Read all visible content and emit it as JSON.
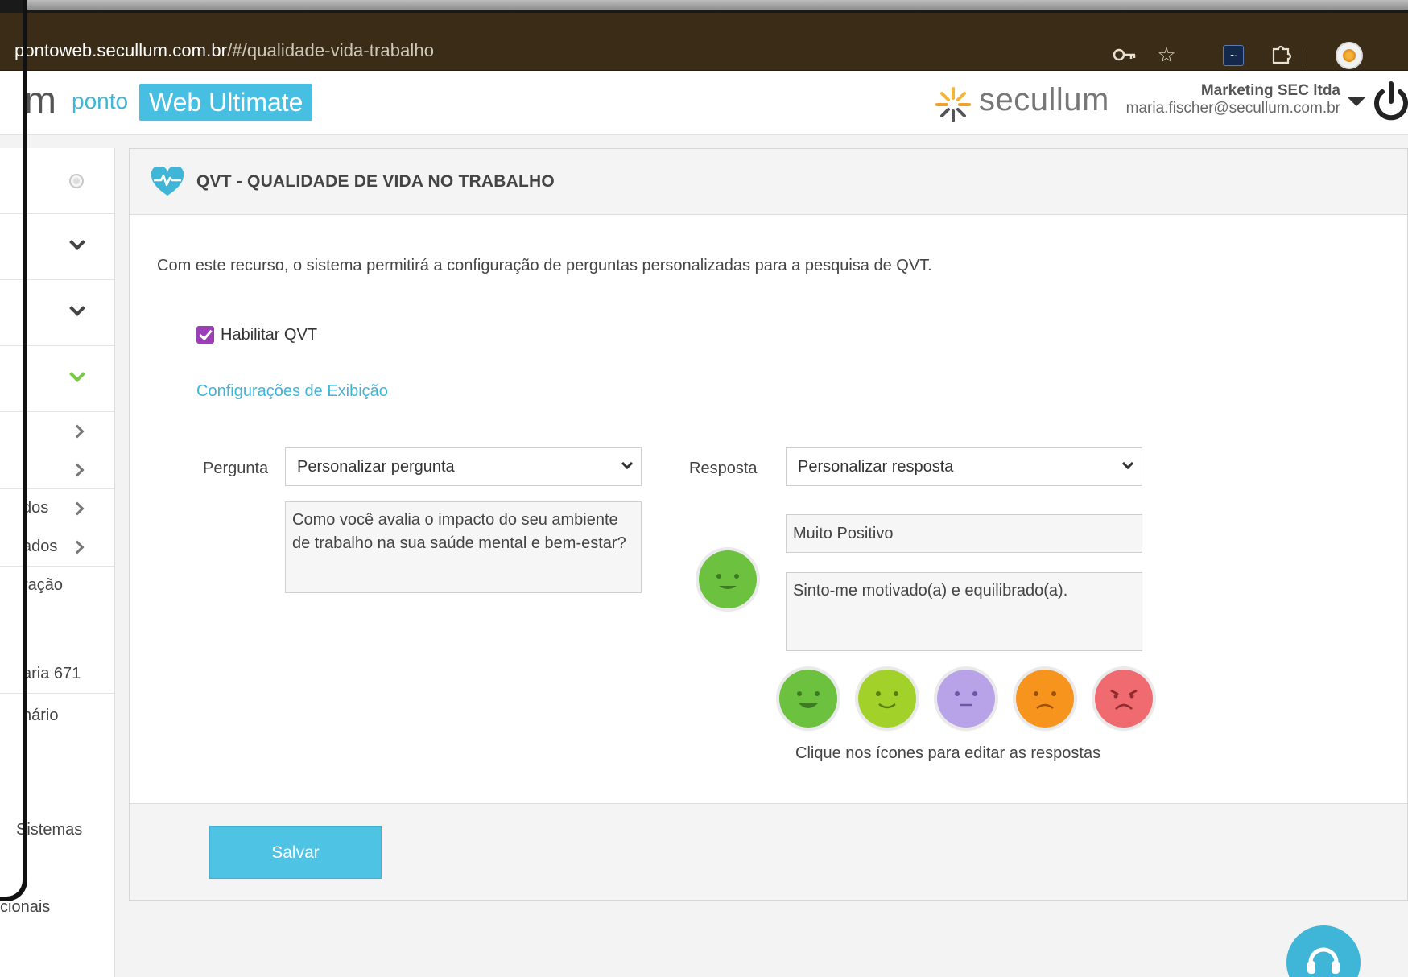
{
  "browser": {
    "url_host": "pontoweb.secullum.com.br",
    "url_path": "/#/qualidade-vida-trabalho",
    "icons": [
      "key-icon",
      "star-icon",
      "extension-icon",
      "puzzle-icon",
      "profile-avatar"
    ]
  },
  "header": {
    "logo_m": "m",
    "logo_ponto": "ponto",
    "logo_badge": "Web Ultimate",
    "brand": "secullum",
    "company": "Marketing SEC ltda",
    "email": "maria.fischer@secullum.com.br"
  },
  "sidebar": {
    "items": [
      {
        "label": "dos"
      },
      {
        "label": "ados"
      },
      {
        "label": "ração"
      },
      {
        "label": "aria 671"
      },
      {
        "label": "nário"
      },
      {
        "label": "Sistemas"
      },
      {
        "label": "cionais"
      }
    ]
  },
  "panel": {
    "title": "QVT - QUALIDADE DE VIDA NO TRABALHO",
    "intro": "Com este recurso, o sistema permitirá a configuração de perguntas personalizadas para a pesquisa de QVT.",
    "enable_label": "Habilitar QVT",
    "enabled": true,
    "config_link": "Configurações de Exibição",
    "question_label": "Pergunta",
    "question_select": "Personalizar pergunta",
    "question_text": "Como você avalia o impacto do seu ambiente de trabalho na sua saúde mental e bem-estar?",
    "answer_label": "Resposta",
    "answer_select": "Personalizar resposta",
    "answer_title": "Muito Positivo",
    "answer_desc": "Sinto-me motivado(a) e equilibrado(a).",
    "hint": "Clique nos ícones para editar as respostas",
    "save_label": "Salvar"
  },
  "faces": [
    {
      "name": "very-positive-face-icon",
      "color": "#6cc13f"
    },
    {
      "name": "positive-face-icon",
      "color": "#a2d22a"
    },
    {
      "name": "neutral-face-icon",
      "color": "#b8a2e8"
    },
    {
      "name": "negative-face-icon",
      "color": "#f7941d"
    },
    {
      "name": "very-negative-face-icon",
      "color": "#ef6b6f"
    }
  ],
  "colors": {
    "accent": "#46bfe2",
    "checkbox": "#9a3fb6",
    "link": "#3fb6d8"
  }
}
